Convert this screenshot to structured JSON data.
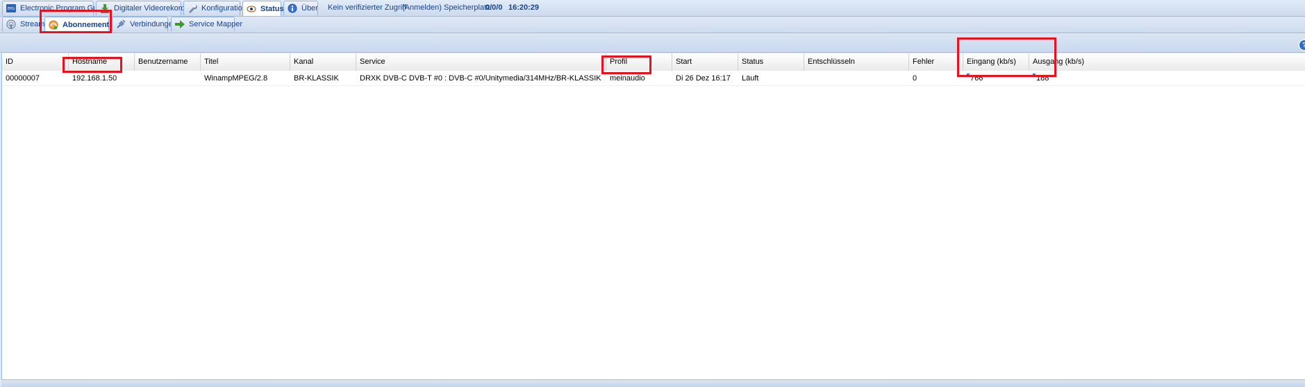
{
  "top_tabs": [
    {
      "label": "Electronic Program Guide",
      "icon": "epg-icon"
    },
    {
      "label": "Digitaler Videorekorder",
      "icon": "download-icon"
    },
    {
      "label": "Konfiguration",
      "icon": "wrench-icon"
    },
    {
      "label": "Status",
      "icon": "eye-icon",
      "active": true
    },
    {
      "label": "Über",
      "icon": "info-icon"
    }
  ],
  "header_info": {
    "access": "Kein verifizierter Zugriff",
    "login": "(Anmelden)",
    "storage_label": "Speicherplatz:",
    "storage_value": "0/0/0",
    "time": "16:20:29"
  },
  "sub_tabs": [
    {
      "label": "Stream",
      "icon": "antenna-icon"
    },
    {
      "label": "Abonnements",
      "icon": "subscription-icon",
      "active": true
    },
    {
      "label": "Verbindungen",
      "icon": "plug-icon"
    },
    {
      "label": "Service Mapper",
      "icon": "arrow-right-icon"
    }
  ],
  "table": {
    "columns": [
      "ID",
      "Hostname",
      "Benutzername",
      "Titel",
      "Kanal",
      "Service",
      "Profil",
      "Start",
      "Status",
      "Entschlüsseln",
      "Fehler",
      "Eingang (kb/s)",
      "Ausgang (kb/s)"
    ],
    "rows": [
      {
        "id": "00000007",
        "hostname": "192.168.1.50",
        "username": "",
        "title": "WinampMPEG/2.8",
        "channel": "BR-KLASSIK",
        "service": "DRXK DVB-C DVB-T #0 : DVB-C #0/Unitymedia/314MHz/BR-KLASSIK",
        "profile": "meinaudio",
        "start": "Di 26 Dez 16:17",
        "status": "Läuft",
        "descramble": "",
        "errors": "0",
        "input": "766",
        "output": "188"
      }
    ]
  },
  "colors": {
    "accent": "#15428b",
    "highlight": "#e8111e",
    "tab_border": "#8db2e3"
  }
}
